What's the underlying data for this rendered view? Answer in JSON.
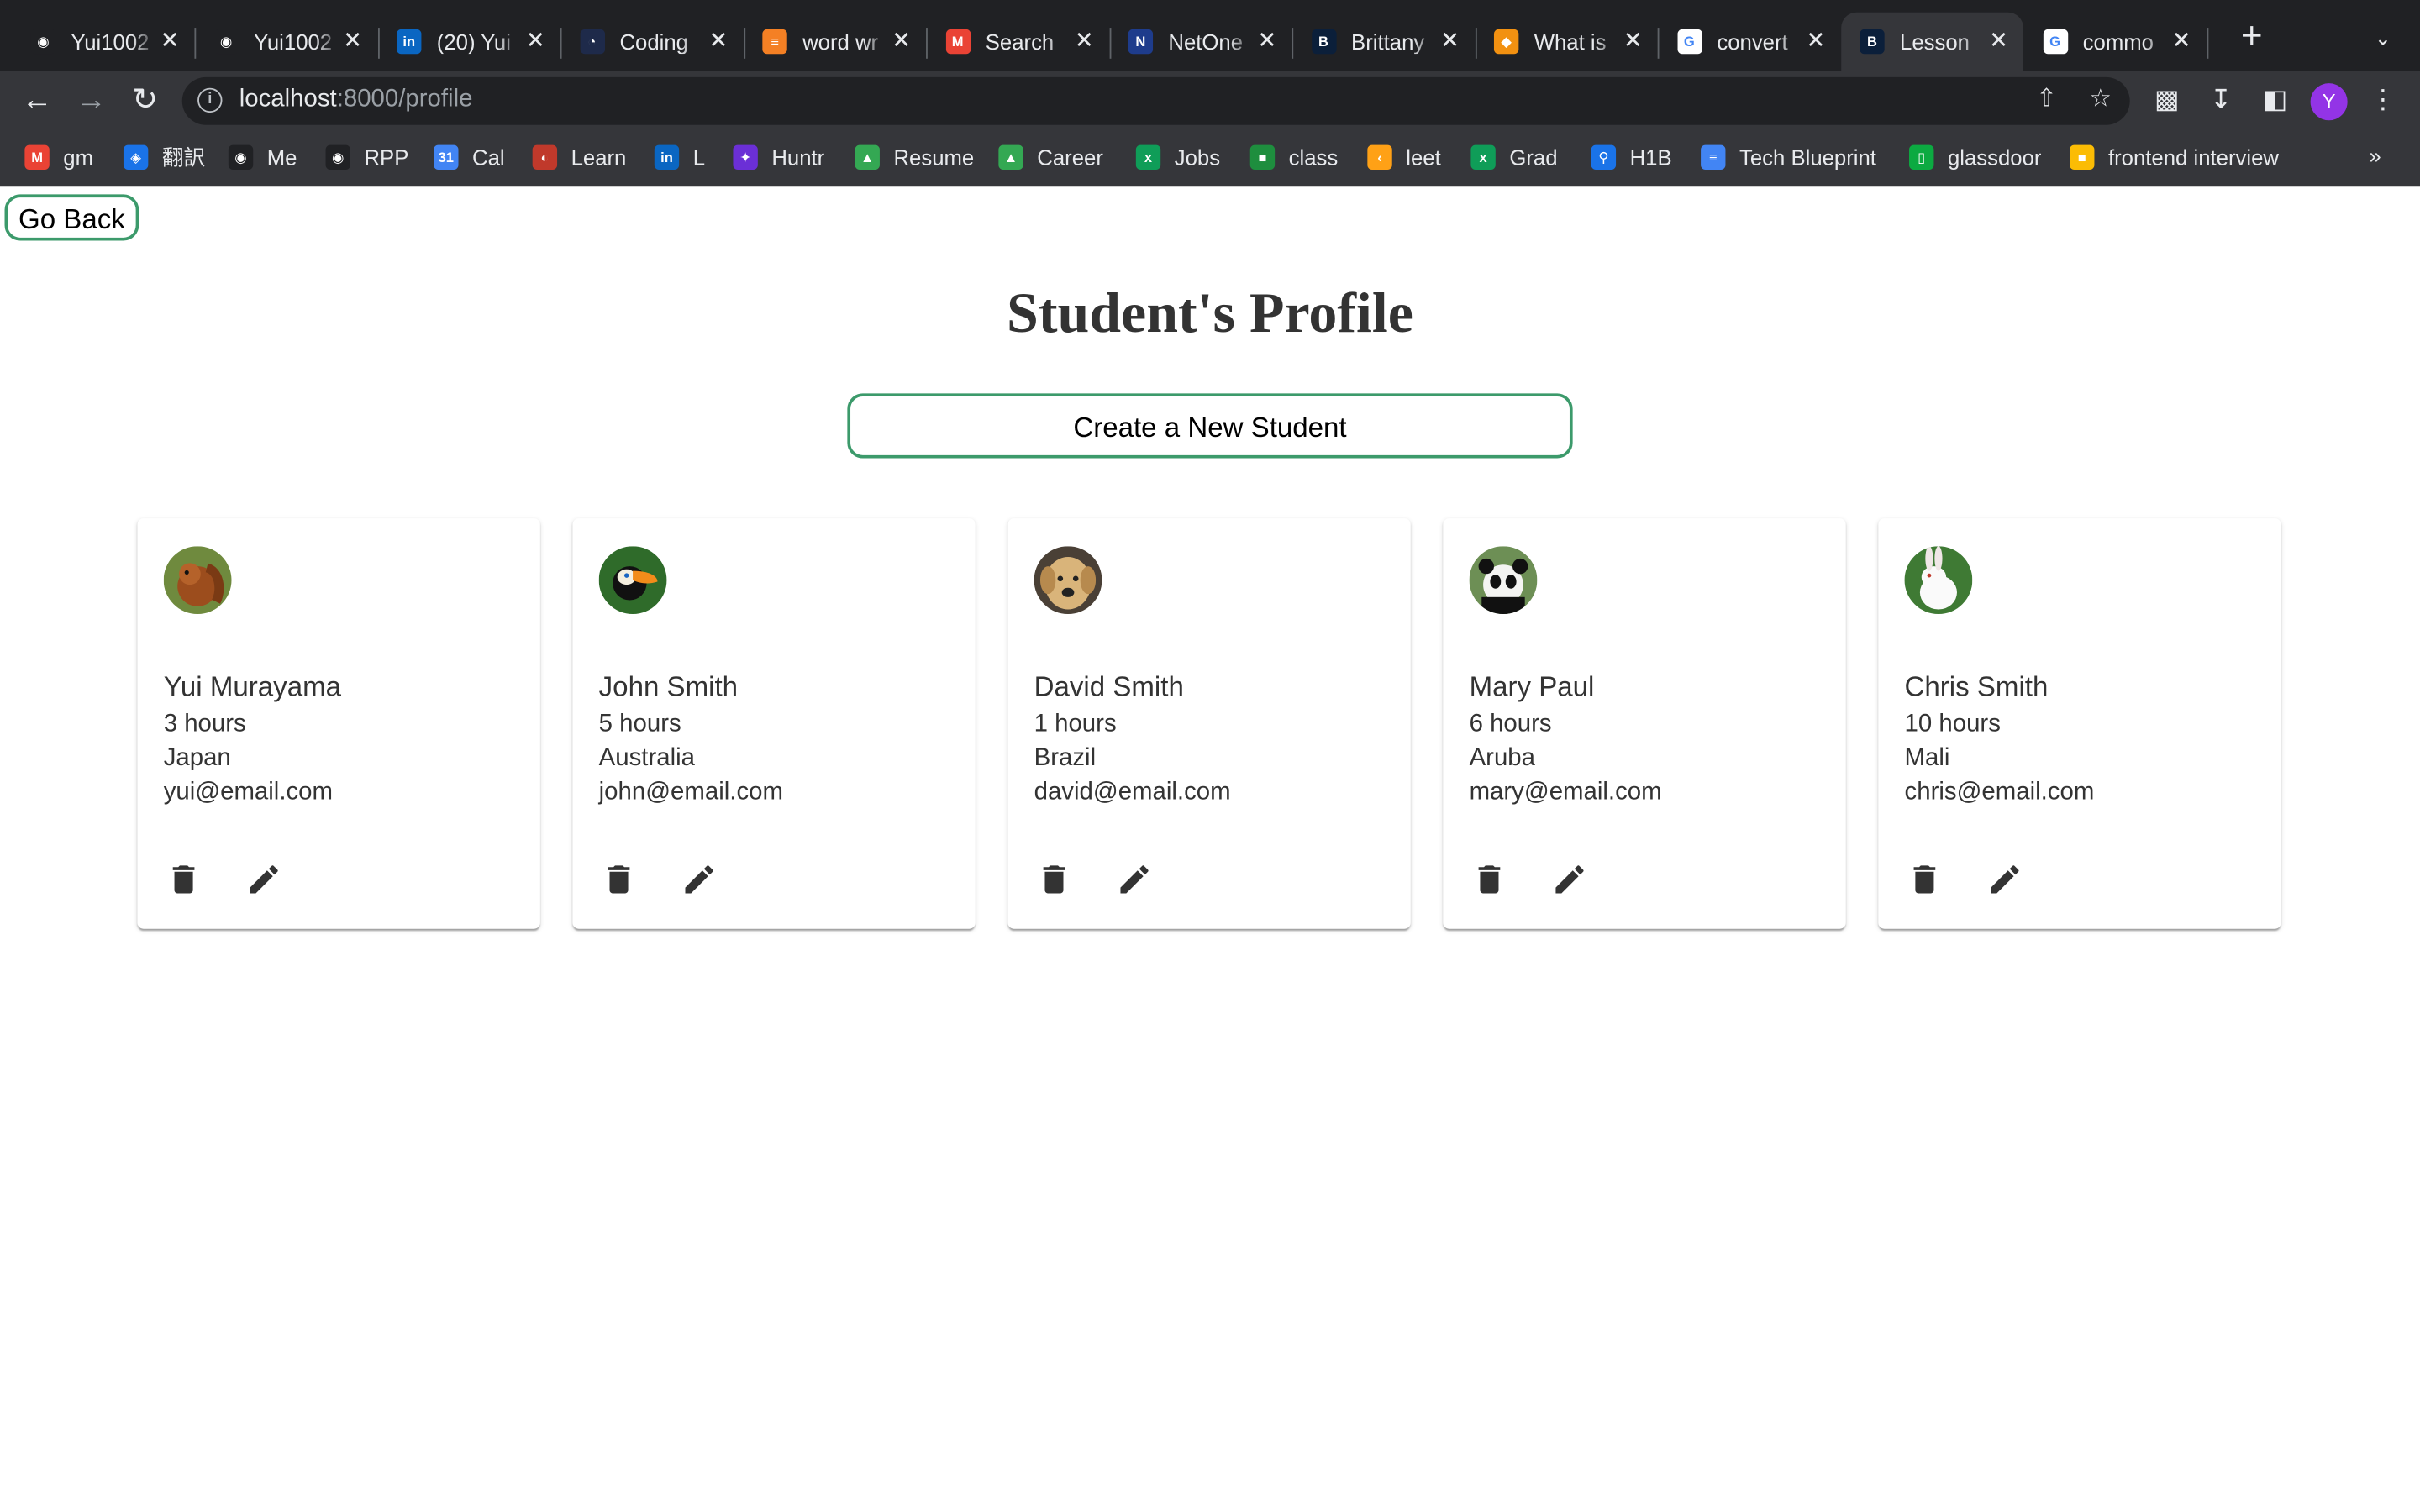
{
  "browser": {
    "tabs": [
      {
        "label": "Yui1002",
        "icon": "github-icon"
      },
      {
        "label": "Yui1002",
        "icon": "github-icon"
      },
      {
        "label": "(20) Yui",
        "icon": "linkedin-icon"
      },
      {
        "label": "Coding",
        "icon": "coding-icon"
      },
      {
        "label": "word wr",
        "icon": "stackoverflow-icon"
      },
      {
        "label": "Search",
        "icon": "gmail-icon"
      },
      {
        "label": "NetOne",
        "icon": "netone-icon"
      },
      {
        "label": "Brittany",
        "icon": "b-icon"
      },
      {
        "label": "What is",
        "icon": "cube-icon"
      },
      {
        "label": "convert",
        "icon": "google-icon"
      },
      {
        "label": "Lesson",
        "icon": "b-icon"
      },
      {
        "label": "commo",
        "icon": "google-icon"
      }
    ],
    "active_tab": 10,
    "url_host": "localhost",
    "url_path": ":8000/profile",
    "profile_initial": "Y",
    "bookmarks": [
      {
        "label": "gm",
        "icon": "gmail-icon"
      },
      {
        "label": "翻訳",
        "icon": "translate-icon"
      },
      {
        "label": "Me",
        "icon": "github-icon"
      },
      {
        "label": "RPP",
        "icon": "github-icon"
      },
      {
        "label": "Cal",
        "icon": "calendar-icon"
      },
      {
        "label": "Learn",
        "icon": "learn-icon"
      },
      {
        "label": "L",
        "icon": "linkedin-icon"
      },
      {
        "label": "Huntr",
        "icon": "huntr-icon"
      },
      {
        "label": "Resume",
        "icon": "drive-icon"
      },
      {
        "label": "Career",
        "icon": "drive-icon"
      },
      {
        "label": "Jobs",
        "icon": "sheets-icon"
      },
      {
        "label": "class",
        "icon": "classroom-icon"
      },
      {
        "label": "leet",
        "icon": "leetcode-icon"
      },
      {
        "label": "Grad",
        "icon": "sheets-icon"
      },
      {
        "label": "H1B",
        "icon": "search-icon"
      },
      {
        "label": "Tech Blueprint",
        "icon": "docs-icon"
      },
      {
        "label": "glassdoor",
        "icon": "glassdoor-icon"
      },
      {
        "label": "frontend interview",
        "icon": "notes-icon"
      }
    ]
  },
  "page": {
    "go_back_label": "Go Back",
    "title": "Student's Profile",
    "create_label": "Create a New Student"
  },
  "students": [
    {
      "name": "Yui Murayama",
      "hours": "3 hours",
      "country": "Japan",
      "email": "yui@email.com",
      "photo": "squirrel"
    },
    {
      "name": "John Smith",
      "hours": "5 hours",
      "country": "Australia",
      "email": "john@email.com",
      "photo": "toucan"
    },
    {
      "name": "David Smith",
      "hours": "1 hours",
      "country": "Brazil",
      "email": "david@email.com",
      "photo": "dog"
    },
    {
      "name": "Mary Paul",
      "hours": "6 hours",
      "country": "Aruba",
      "email": "mary@email.com",
      "photo": "panda"
    },
    {
      "name": "Chris Smith",
      "hours": "10 hours",
      "country": "Mali",
      "email": "chris@email.com",
      "photo": "rabbit"
    }
  ],
  "colors": {
    "accent_border": "#3c9a6b",
    "tabstrip": "#202124",
    "toolbar": "#35363a"
  }
}
